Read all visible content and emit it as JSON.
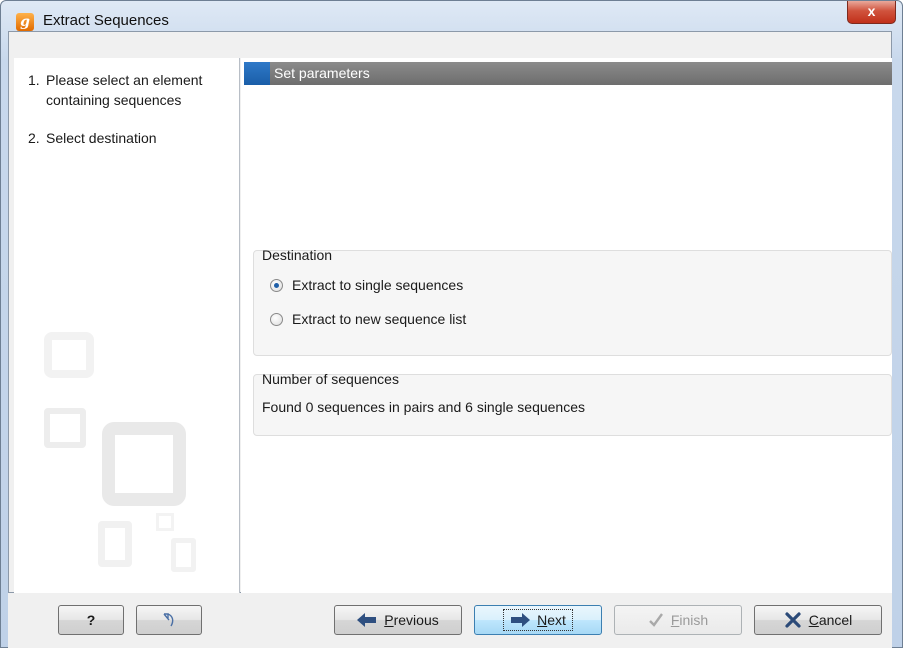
{
  "window": {
    "title": "Extract Sequences",
    "app_icon_glyph": "g",
    "close_glyph": "x"
  },
  "steps": [
    {
      "number": "1.",
      "line1": "Please select an element",
      "line2": "containing sequences"
    },
    {
      "number": "2.",
      "line1": "Select destination"
    }
  ],
  "panel": {
    "header": "Set parameters"
  },
  "destination": {
    "title": "Destination",
    "options": [
      {
        "label": "Extract to single sequences",
        "checked": true
      },
      {
        "label": "Extract to new sequence list",
        "checked": false
      }
    ]
  },
  "count": {
    "title": "Number of sequences",
    "text": "Found 0 sequences in pairs and 6 single sequences"
  },
  "buttons": {
    "help": "?",
    "reset_icon": "reset-arrow-icon",
    "previous": {
      "mnemonic": "P",
      "rest": "revious"
    },
    "next": {
      "mnemonic": "N",
      "rest": "ext"
    },
    "finish": {
      "mnemonic": "F",
      "rest": "inish",
      "enabled": false
    },
    "cancel": {
      "mnemonic": "C",
      "rest": "ancel"
    }
  },
  "colors": {
    "accent": "#1a5ea8",
    "header_bar": "#777777",
    "close": "#c1301a"
  }
}
